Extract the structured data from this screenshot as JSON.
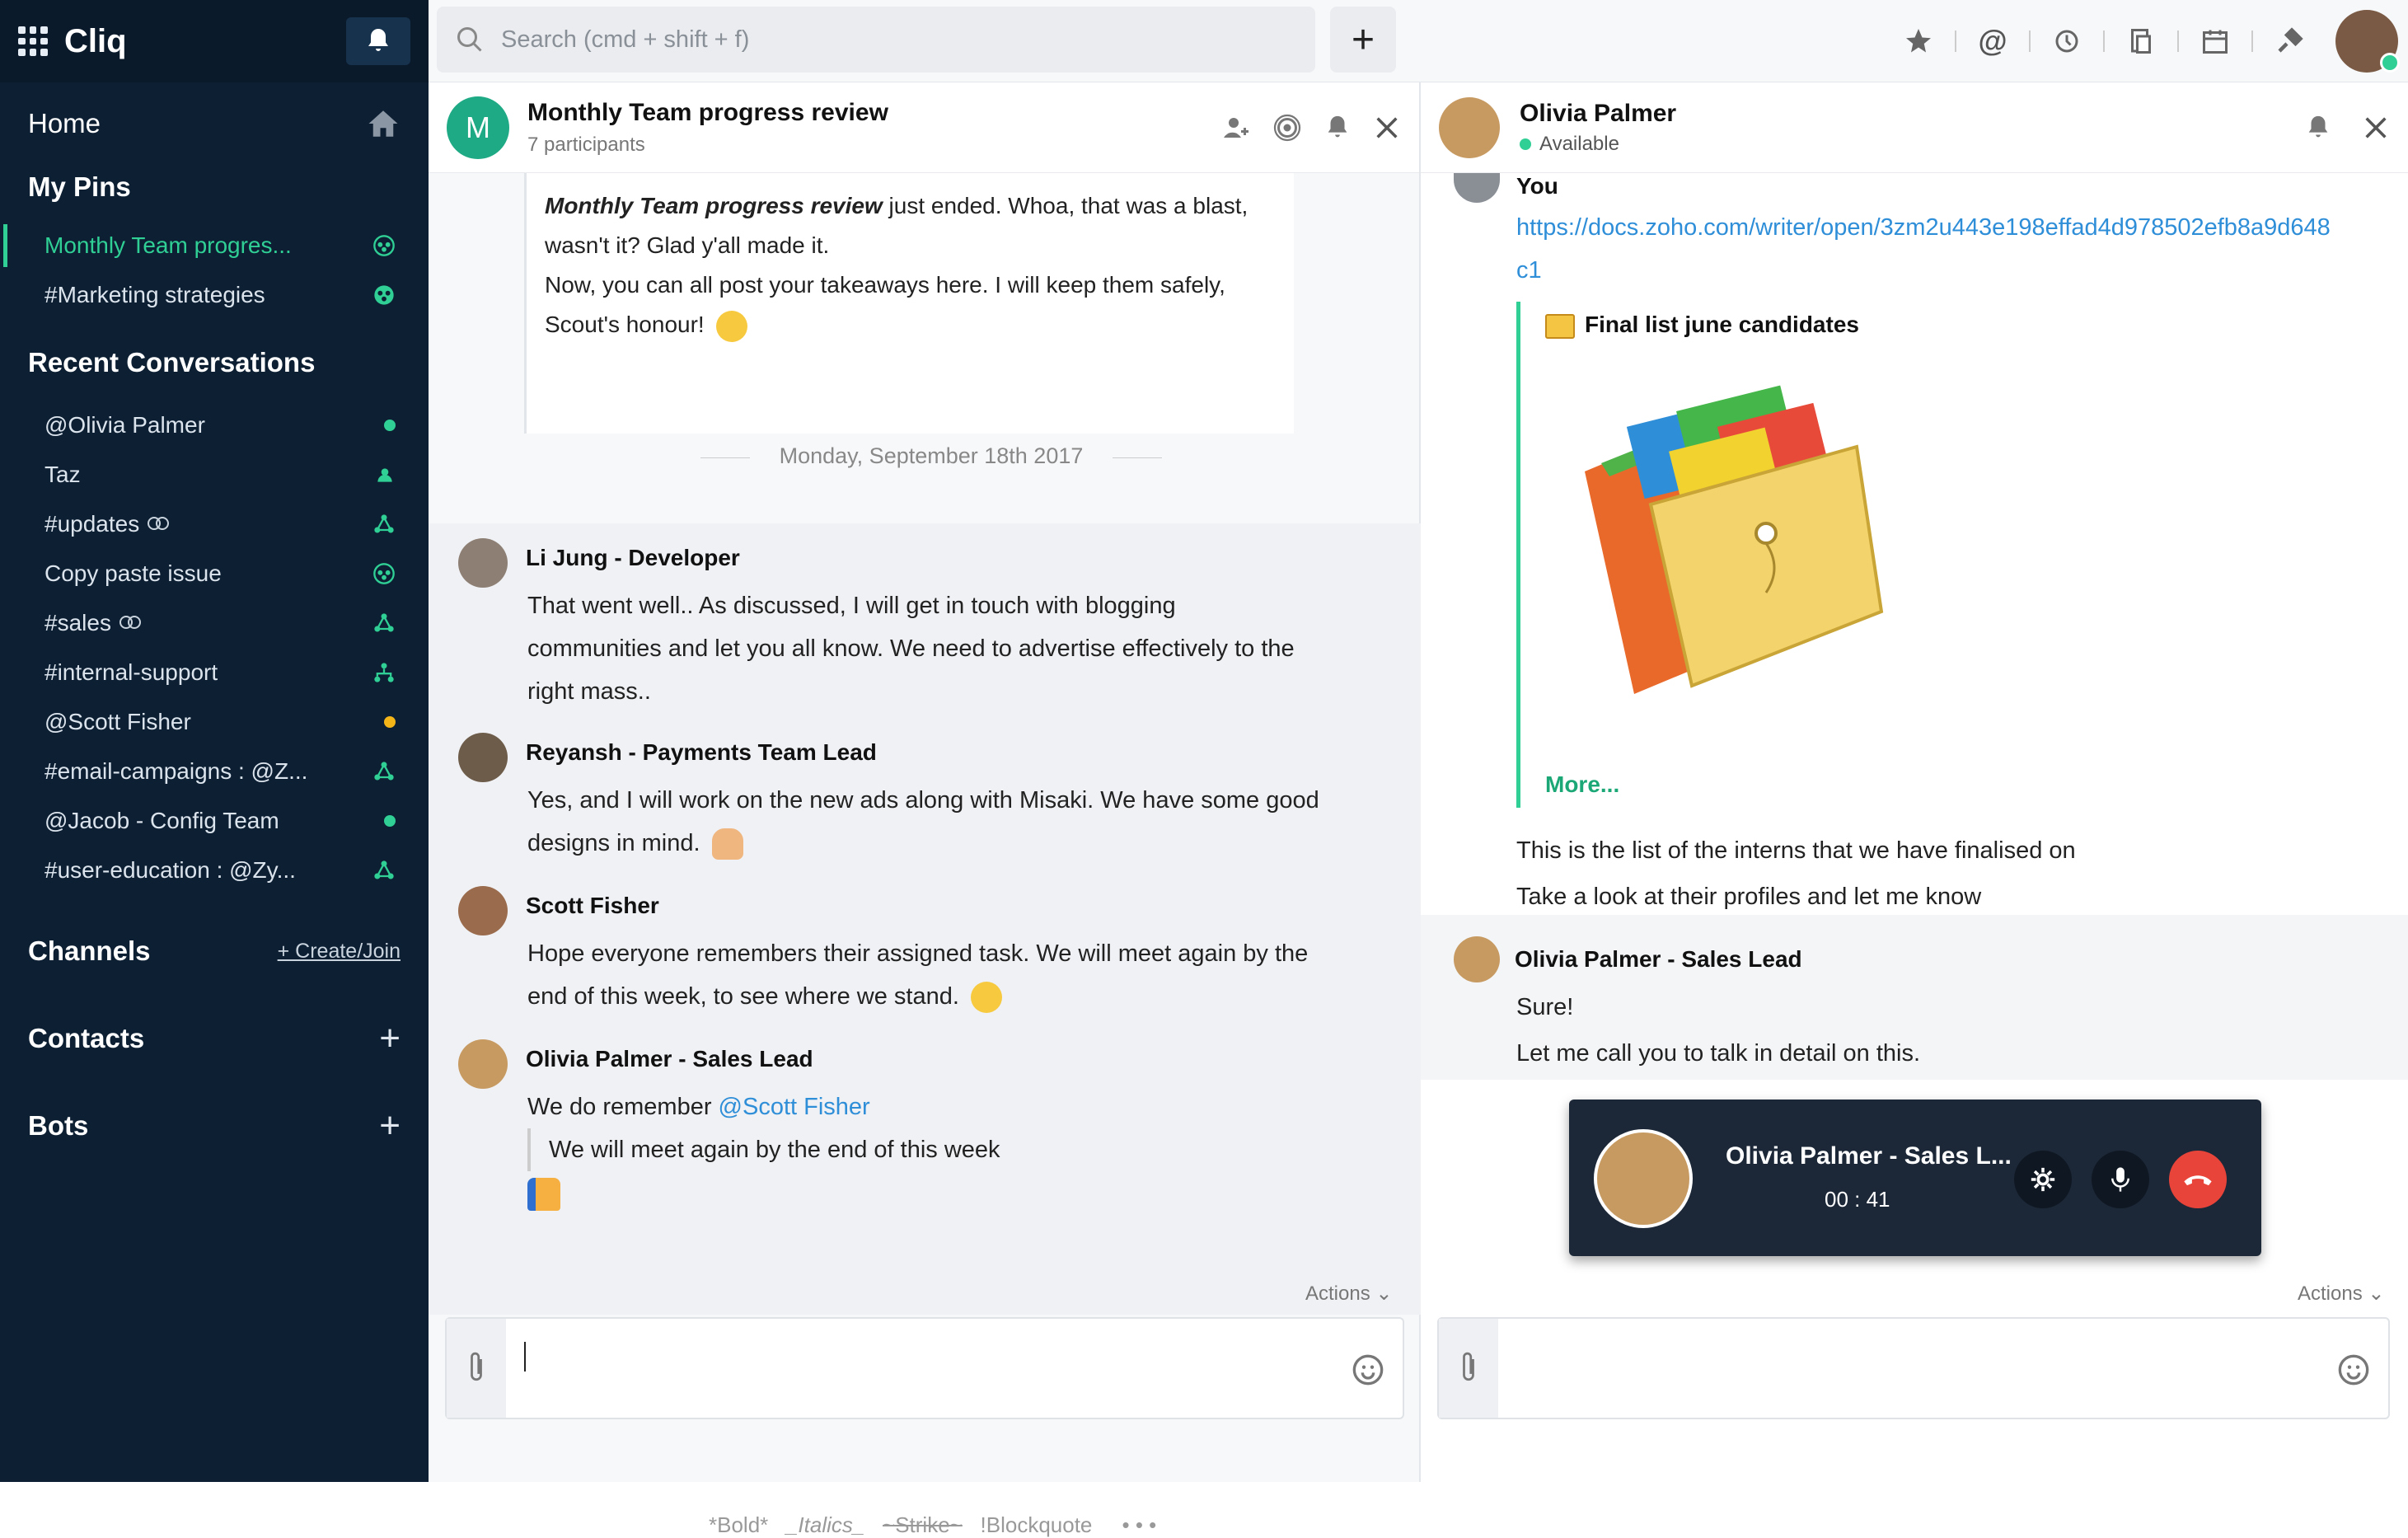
{
  "app": {
    "name": "Cliq"
  },
  "sidebar": {
    "home": "Home",
    "pins_title": "My Pins",
    "pins": [
      {
        "label": "Monthly Team progres..."
      },
      {
        "label": "#Marketing strategies"
      }
    ],
    "recent_title": "Recent Conversations",
    "recent": [
      {
        "label": "@Olivia Palmer"
      },
      {
        "label": "Taz"
      },
      {
        "label": "#updates"
      },
      {
        "label": "Copy paste issue"
      },
      {
        "label": "#sales"
      },
      {
        "label": "#internal-support"
      },
      {
        "label": "@Scott Fisher"
      },
      {
        "label": "#email-campaigns : @Z..."
      },
      {
        "label": "@Jacob - Config Team"
      },
      {
        "label": "#user-education : @Zy..."
      }
    ],
    "channels_title": "Channels",
    "create_join": "+ Create/Join",
    "contacts_title": "Contacts",
    "bots_title": "Bots"
  },
  "topbar": {
    "search_placeholder": "Search (cmd + shift + f)"
  },
  "left_chat": {
    "avatar_letter": "M",
    "title": "Monthly Team progress review",
    "participants": "7 participants",
    "bot_msg_bold": "Monthly Team progress review",
    "bot_msg_line1_rest": " just ended. Whoa, that was a blast,",
    "bot_msg_line2": "wasn't it? Glad y'all made it.",
    "bot_msg_line3": "Now, you can all post your takeaways here. I will keep them safely,",
    "bot_msg_line4": "Scout's honour!",
    "date": "Monday, September 18th 2017",
    "messages": [
      {
        "name": "Li Jung - Developer",
        "lines": [
          "That went well.. As discussed, I will get in touch with blogging",
          "communities and let you all know. We need to advertise effectively to the",
          "right mass.."
        ]
      },
      {
        "name": "Reyansh - Payments Team Lead",
        "lines": [
          "Yes, and I will work on the new ads along with Misaki. We have some good",
          "designs in mind."
        ]
      },
      {
        "name": "Scott Fisher",
        "lines": [
          "Hope everyone remembers their assigned task. We will meet again by the",
          "end of this week, to see where we stand."
        ]
      },
      {
        "name": "Olivia Palmer - Sales Lead",
        "line_prefix": "We do remember ",
        "mention": "@Scott Fisher",
        "quote": "We will meet again by the end of this week"
      }
    ],
    "actions": "Actions",
    "format_hint": {
      "bold": "*Bold*",
      "italics": "_Italics_",
      "strike": "~Strike~",
      "blockquote": "!Blockquote",
      "more": "• • •"
    }
  },
  "right_chat": {
    "name": "Olivia Palmer",
    "status": "Available",
    "you_label": "You",
    "link": "https://docs.zoho.com/writer/open/3zm2u443e198effad4d978502efb8a9d648c1",
    "attachment_title": "Final list june candidates",
    "more": "More...",
    "text1": "This is the list of the interns that we have finalised on",
    "text2": "Take a look at their profiles and let me know",
    "reply_name": "Olivia Palmer - Sales Lead",
    "reply1": "Sure!",
    "reply2": "Let me call you to talk in detail on this.",
    "call_name": "Olivia Palmer - Sales L...",
    "call_time": "00 : 41",
    "actions": "Actions"
  }
}
